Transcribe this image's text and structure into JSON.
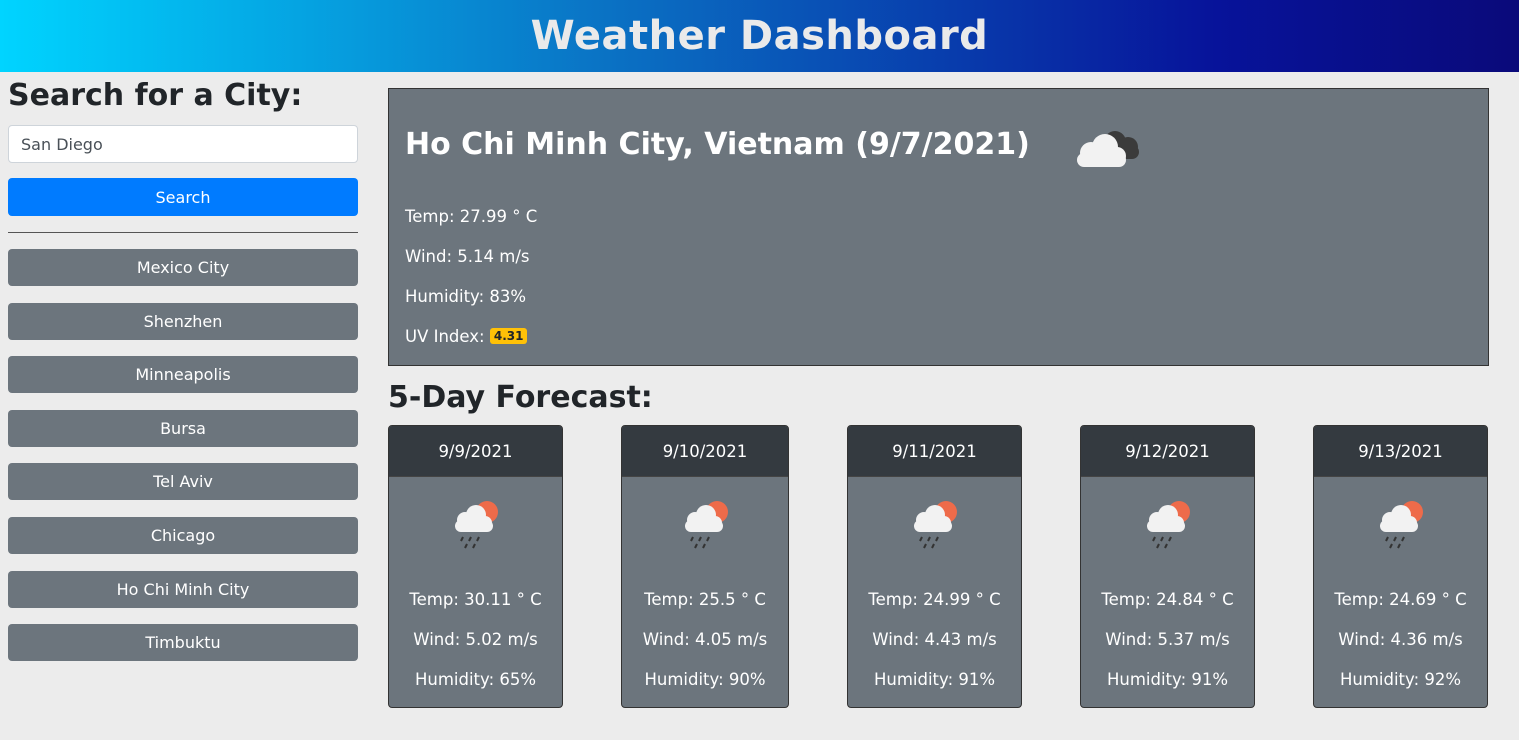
{
  "header": {
    "title": "Weather Dashboard"
  },
  "sidebar": {
    "heading": "Search for a City:",
    "search_value": "San Diego",
    "search_button": "Search",
    "history": [
      "Mexico City",
      "Shenzhen",
      "Minneapolis",
      "Bursa",
      "Tel Aviv",
      "Chicago",
      "Ho Chi Minh City",
      "Timbuktu"
    ]
  },
  "current": {
    "title": "Ho Chi Minh City, Vietnam (9/7/2021)",
    "icon": "cloudy-icon",
    "temp": "Temp: 27.99 ° C",
    "wind": "Wind: 5.14 m/s",
    "humidity": "Humidity: 83%",
    "uv_label": "UV Index:",
    "uv_value": "4.31",
    "uv_color": "#ffc107"
  },
  "forecast": {
    "title": "5-Day Forecast:",
    "days": [
      {
        "date": "9/9/2021",
        "icon": "rain-sun-icon",
        "temp": "Temp: 30.11 ° C",
        "wind": "Wind: 5.02 m/s",
        "humidity": "Humidity: 65%"
      },
      {
        "date": "9/10/2021",
        "icon": "rain-sun-icon",
        "temp": "Temp: 25.5 ° C",
        "wind": "Wind: 4.05 m/s",
        "humidity": "Humidity: 90%"
      },
      {
        "date": "9/11/2021",
        "icon": "rain-sun-icon",
        "temp": "Temp: 24.99 ° C",
        "wind": "Wind: 4.43 m/s",
        "humidity": "Humidity: 91%"
      },
      {
        "date": "9/12/2021",
        "icon": "rain-sun-icon",
        "temp": "Temp: 24.84 ° C",
        "wind": "Wind: 5.37 m/s",
        "humidity": "Humidity: 91%"
      },
      {
        "date": "9/13/2021",
        "icon": "rain-sun-icon",
        "temp": "Temp: 24.69 ° C",
        "wind": "Wind: 4.36 m/s",
        "humidity": "Humidity: 92%"
      }
    ]
  },
  "colors": {
    "primary": "#007bff",
    "secondary": "#6c757d",
    "dark": "#343a40",
    "background": "#ececec"
  }
}
